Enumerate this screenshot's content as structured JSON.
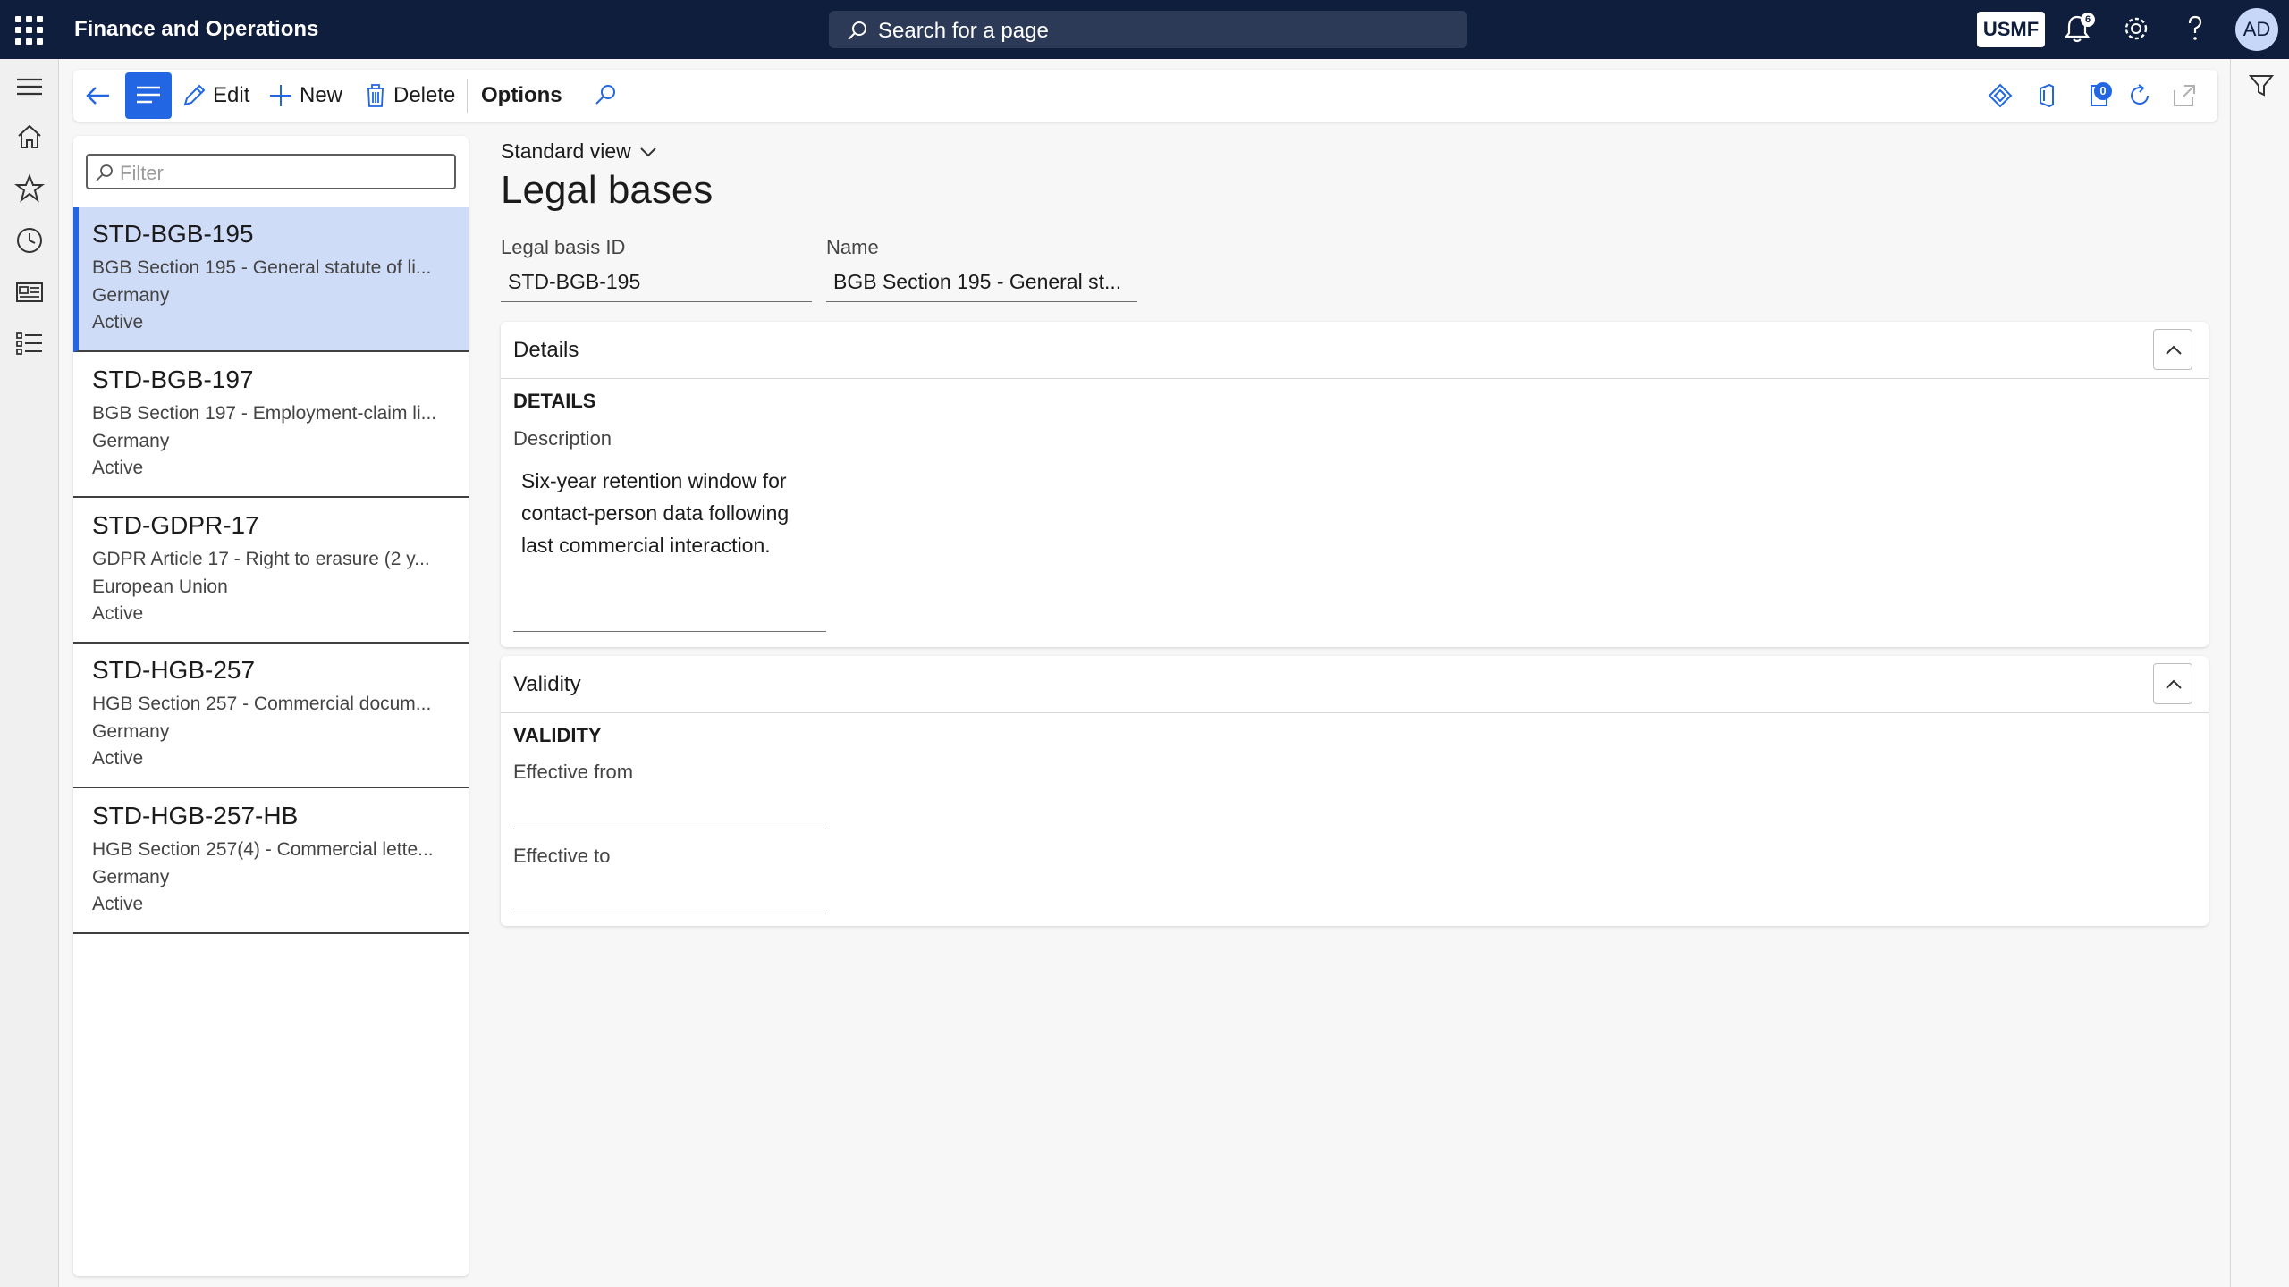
{
  "app": {
    "title": "Finance and Operations",
    "search_placeholder": "Search for a page",
    "company": "USMF",
    "notification_count": "6",
    "user_initials": "AD"
  },
  "actions": {
    "edit": "Edit",
    "new": "New",
    "delete": "Delete",
    "options": "Options",
    "attachments_count": "0"
  },
  "list": {
    "filter_placeholder": "Filter",
    "items": [
      {
        "id": "STD-BGB-195",
        "name": "BGB Section 195 - General statute of li...",
        "country": "Germany",
        "status": "Active"
      },
      {
        "id": "STD-BGB-197",
        "name": "BGB Section 197 - Employment-claim li...",
        "country": "Germany",
        "status": "Active"
      },
      {
        "id": "STD-GDPR-17",
        "name": "GDPR Article 17 - Right to erasure (2 y...",
        "country": "European Union",
        "status": "Active"
      },
      {
        "id": "STD-HGB-257",
        "name": "HGB Section 257 - Commercial docum...",
        "country": "Germany",
        "status": "Active"
      },
      {
        "id": "STD-HGB-257-HB",
        "name": "HGB Section 257(4) - Commercial lette...",
        "country": "Germany",
        "status": "Active"
      }
    ]
  },
  "form": {
    "view": "Standard view",
    "title": "Legal bases",
    "id_label": "Legal basis ID",
    "id_value": "STD-BGB-195",
    "name_label": "Name",
    "name_value": "BGB Section 195 - General st..."
  },
  "details": {
    "tab_title": "Details",
    "section": "DETAILS",
    "description_label": "Description",
    "description_value": "Six-year retention window for contact-person data following last commercial interaction."
  },
  "validity": {
    "tab_title": "Validity",
    "section": "VALIDITY",
    "from_label": "Effective from",
    "from_value": "",
    "to_label": "Effective to",
    "to_value": ""
  },
  "colors": {
    "topbar": "#0f1e3c",
    "accent": "#2266e3",
    "selected_row": "#cfdcf7"
  }
}
